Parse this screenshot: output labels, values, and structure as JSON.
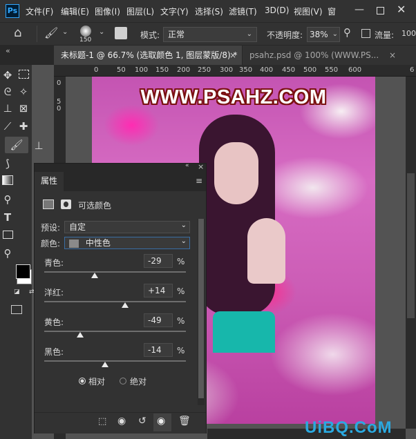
{
  "menubar": {
    "logo": "Ps",
    "items": [
      "文件(F)",
      "编辑(E)",
      "图像(I)",
      "图层(L)",
      "文字(Y)",
      "选择(S)",
      "滤镜(T)",
      "3D(D)",
      "视图(V)",
      "窗"
    ]
  },
  "options": {
    "brush_size": "150",
    "mode_label": "模式:",
    "mode_value": "正常",
    "opacity_label": "不透明度:",
    "opacity_value": "38%",
    "flow_label": "流量:",
    "flow_value": "100"
  },
  "tabs": [
    {
      "label": "未标题-1 @ 66.7% (选取颜色 1, 图层蒙版/8) *",
      "close": "×"
    },
    {
      "label": "psahz.psd @ 100% (WWW.PS...",
      "close": "×"
    }
  ],
  "toolbar": {
    "collapse": "«"
  },
  "ruler": {
    "top": [
      "0",
      "50",
      "100",
      "150",
      "200",
      "250",
      "300",
      "350",
      "400",
      "450",
      "500",
      "550",
      "600",
      "6"
    ],
    "left": [
      "0",
      "5",
      "0"
    ]
  },
  "canvas": {
    "watermark": "WWW.PSAHZ.COM"
  },
  "site_watermark": "UiBQ.CoM",
  "panel": {
    "collapse": "«",
    "close": "×",
    "tab": "属性",
    "title": "可选颜色",
    "preset_label": "预设:",
    "preset_value": "自定",
    "color_label": "颜色:",
    "color_value": "中性色",
    "sliders": [
      {
        "label": "青色:",
        "value": "-29",
        "unit": "%",
        "level": -29
      },
      {
        "label": "洋红:",
        "value": "+14",
        "unit": "%",
        "level": 14
      },
      {
        "label": "黄色:",
        "value": "-49",
        "unit": "%",
        "level": -49
      },
      {
        "label": "黑色:",
        "value": "-14",
        "unit": "%",
        "level": -14
      }
    ],
    "method_relative": "相对",
    "method_absolute": "绝对"
  },
  "colors": {
    "accent": "#31a8ff",
    "foreground": "#000000",
    "background": "#ffffff"
  }
}
